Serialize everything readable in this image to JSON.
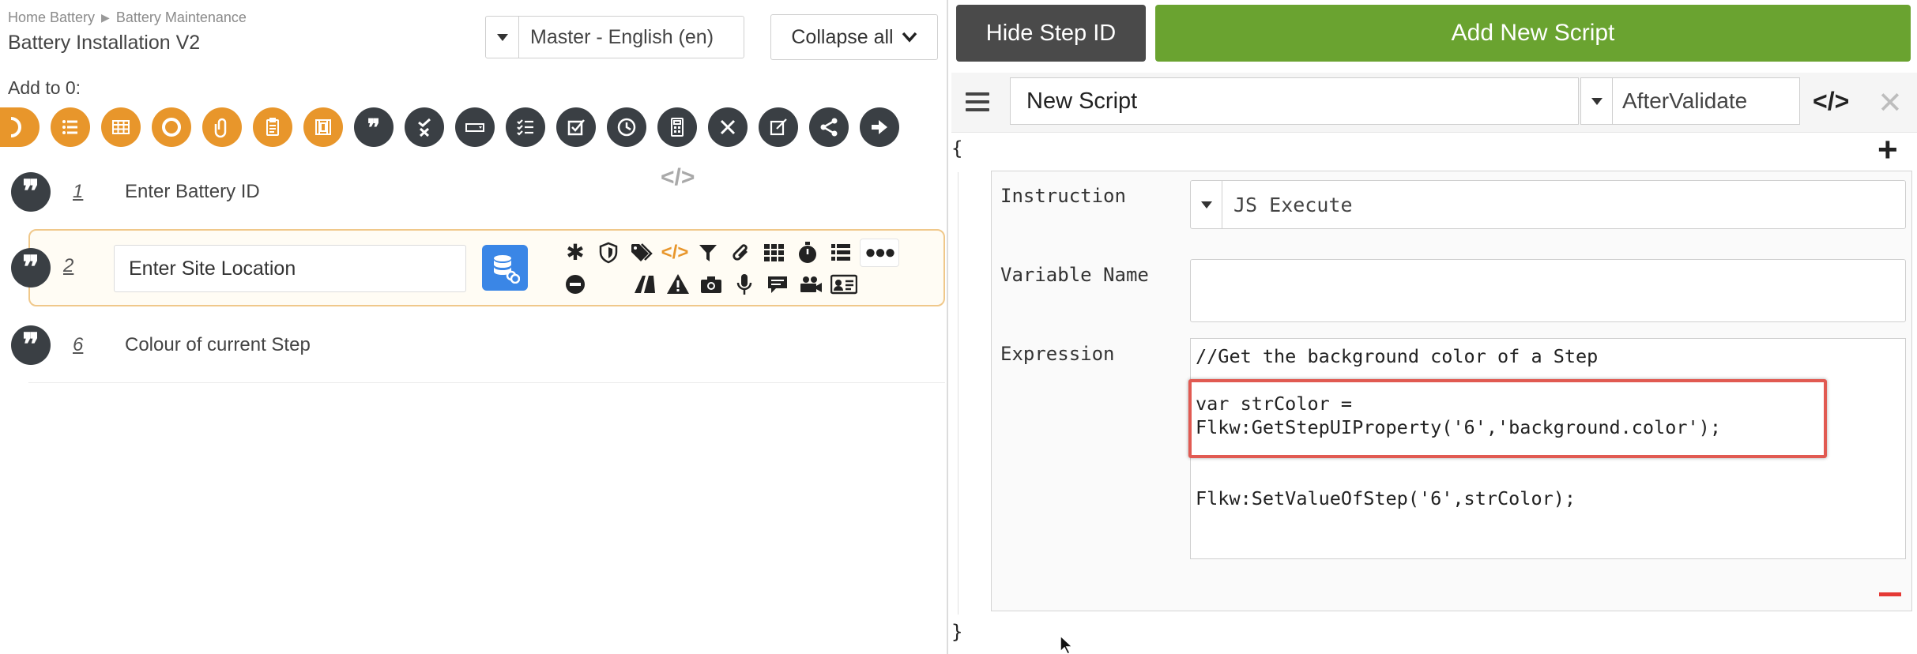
{
  "left": {
    "breadcrumb": [
      "Home Battery",
      "Battery Maintenance"
    ],
    "breadcrumb_separator": "▶",
    "title": "Battery Installation V2",
    "language_select": "Master - English (en)",
    "collapse_label": "Collapse all",
    "add_to_label": "Add to 0:",
    "code_toggle": "</>",
    "steps": [
      {
        "number": "1",
        "label": "Enter Battery ID"
      },
      {
        "number": "2",
        "label": "Enter Site Location"
      },
      {
        "number": "6",
        "label": "Colour of current Step"
      }
    ]
  },
  "right": {
    "hide_step_label": "Hide Step ID",
    "add_script_label": "Add New Script",
    "script_name": "New Script",
    "event_select": "AfterValidate",
    "code_button": "</>",
    "close_button": "✕",
    "open_brace": "{",
    "close_brace": "}",
    "plus_label": "+",
    "instruction_label": "Instruction",
    "instruction_value": "JS Execute",
    "variable_name_label": "Variable Name",
    "variable_name_value": "",
    "expression_label": "Expression",
    "code_lines": [
      "//Get the background color of a Step",
      "var strColor =",
      "Flkw:GetStepUIProperty('6','background.color');",
      "Flkw:SetValueOfStep('6',strColor);"
    ]
  },
  "colors": {
    "accent_orange": "#e8962b",
    "dark_icon": "#3a3f44",
    "add_green": "#6aa330",
    "hide_grey": "#4a4a4a",
    "highlight_red": "#e15a52",
    "db_blue": "#3a86e6"
  },
  "icons": {
    "add_toolbar": [
      "half-circle-icon",
      "list-icon",
      "grid-table-icon",
      "circle-icon",
      "attachment-icon",
      "clipboard-icon",
      "film-icon",
      "quote-icon",
      "check-x-icon",
      "input-box-icon",
      "checklist-icon",
      "checkbox-icon",
      "clock-icon",
      "calculator-icon",
      "tools-icon",
      "edit-icon",
      "share-icon",
      "arrow-right-icon"
    ]
  }
}
